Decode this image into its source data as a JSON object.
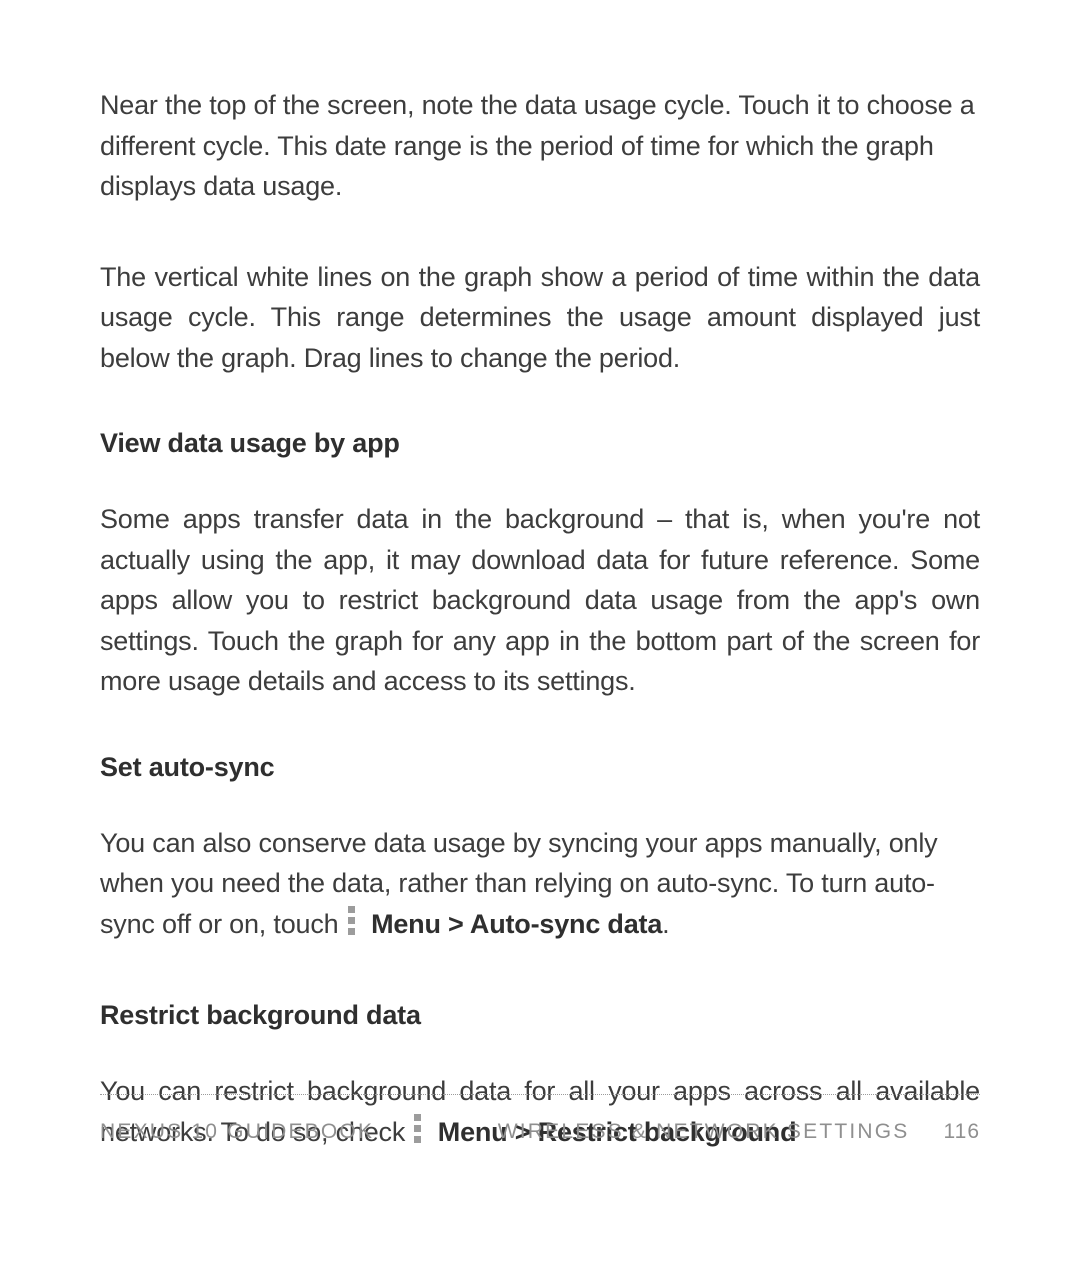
{
  "body": {
    "para1": "Near the top of the screen, note the data usage cycle. Touch it to choose a different cycle. This date range is the period of time for which the graph displays data usage.",
    "para2": "The vertical white lines on the graph show a period of time within the data usage cycle. This range determines the usage amount displayed just below the graph. Drag lines to change the period.",
    "h1": "View data usage by app",
    "para3": "Some apps transfer data in the background – that is, when you're not actually using the app, it may download data for future reference. Some apps allow you to restrict background data usage from the app's own settings. Touch the graph for any app in the bottom part of the screen for more usage details and access to its settings.",
    "h2": "Set auto-sync",
    "para4_a": "You can also conserve data usage by syncing your apps manually, only when you need the data, rather than relying on auto-sync. To turn auto-sync off or on, touch ",
    "para4_bold": "Menu > Auto-sync data",
    "para4_b": ".",
    "h3": "Restrict background data",
    "para5_a": "You can restrict background data for all your apps across all available networks. To do so, check ",
    "para5_bold": "Menu > Restrict background"
  },
  "footer": {
    "left": "NEXUS 10 GUIDEBOOK",
    "center": "WIRELESS & NETWORK SETTINGS",
    "page": "116"
  }
}
